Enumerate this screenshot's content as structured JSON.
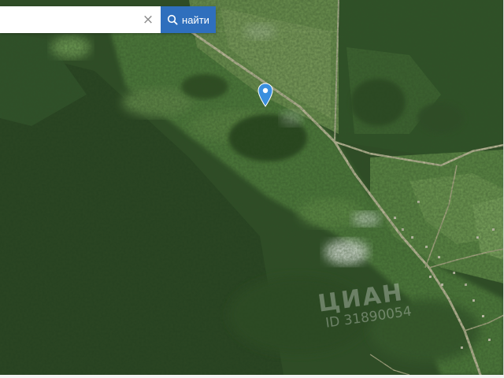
{
  "search": {
    "value": "",
    "placeholder": "",
    "clear_glyph": "×",
    "button_label": "найти",
    "button_icon": "search-icon",
    "button_color": "#2f6fbd"
  },
  "map": {
    "layer": "satellite",
    "marker_icon": "map-pin-icon",
    "marker_color": "#3a8fde"
  },
  "watermark": {
    "logo": "ЦИАН",
    "listing_id": "ID 31890054"
  }
}
